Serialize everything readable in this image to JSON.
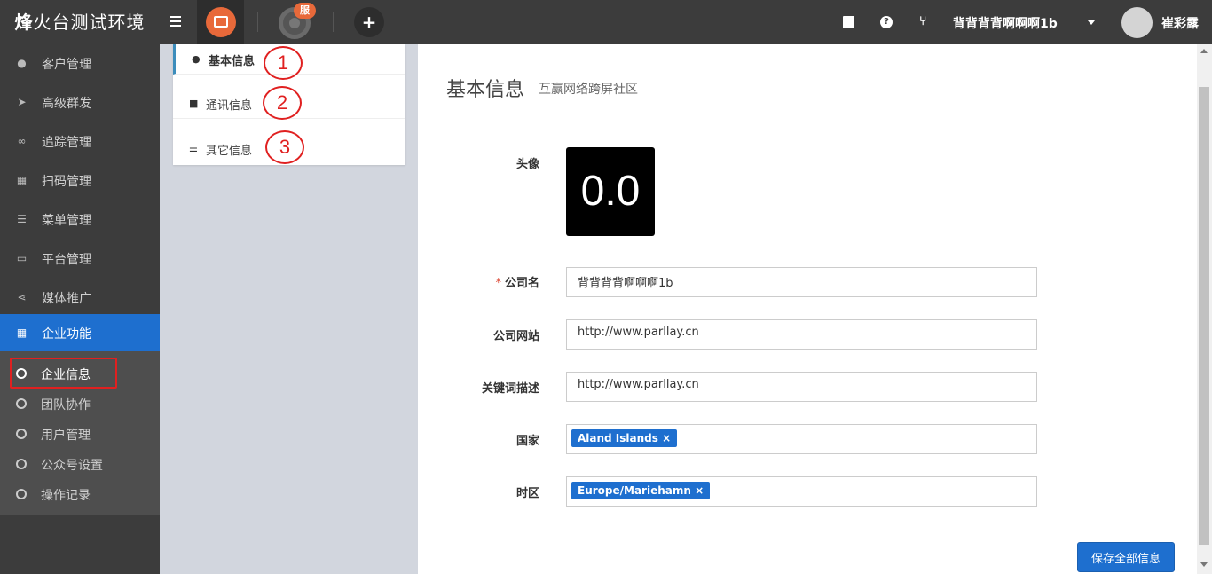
{
  "brand": {
    "first": "烽",
    "rest": "火台测试环境"
  },
  "topbar": {
    "badge": "服",
    "company_name": "背背背背啊啊啊1b",
    "user_name": "崔彩露",
    "icons": [
      "menu-icon",
      "app-icon",
      "service-app-icon",
      "plus-icon",
      "book-icon",
      "help-icon",
      "fork-icon"
    ]
  },
  "sidebar": {
    "items": [
      {
        "label": "客户管理",
        "icon": "user-icon"
      },
      {
        "label": "高级群发",
        "icon": "paper-plane-icon"
      },
      {
        "label": "追踪管理",
        "icon": "link-icon"
      },
      {
        "label": "扫码管理",
        "icon": "qrcode-icon"
      },
      {
        "label": "菜单管理",
        "icon": "list-icon"
      },
      {
        "label": "平台管理",
        "icon": "desktop-icon"
      },
      {
        "label": "媒体推广",
        "icon": "share-icon"
      },
      {
        "label": "企业功能",
        "icon": "grid-icon",
        "active": true
      }
    ],
    "submenu": [
      {
        "label": "企业信息",
        "active": true
      },
      {
        "label": "团队协作"
      },
      {
        "label": "用户管理"
      },
      {
        "label": "公众号设置"
      },
      {
        "label": "操作记录"
      }
    ]
  },
  "tabs": [
    {
      "label": "基本信息",
      "icon": "user-icon",
      "active": true
    },
    {
      "label": "通讯信息",
      "icon": "lock-icon"
    },
    {
      "label": "其它信息",
      "icon": "list-icon"
    }
  ],
  "annotations": [
    "1",
    "2",
    "3"
  ],
  "main": {
    "title": "基本信息",
    "subtitle": "互赢网络跨屏社区",
    "avatar_label": "头像",
    "avatar_text": "0.0",
    "fields": [
      {
        "label": "公司名",
        "required_mark": "*",
        "value": "背背背背啊啊啊1b"
      },
      {
        "label": "公司网站",
        "value": "http://www.parllay.cn"
      },
      {
        "label": "关键词描述",
        "value": "http://www.parllay.cn"
      },
      {
        "label": "国家",
        "tag": "Aland Islands ×"
      },
      {
        "label": "时区",
        "tag": "Europe/Mariehamn ×"
      }
    ],
    "save_label": "保存全部信息"
  },
  "colors": {
    "accent": "#1e6fcf",
    "annotation": "#e02020",
    "sidebar_bg": "#3c3c3c",
    "orange": "#e8693a"
  }
}
